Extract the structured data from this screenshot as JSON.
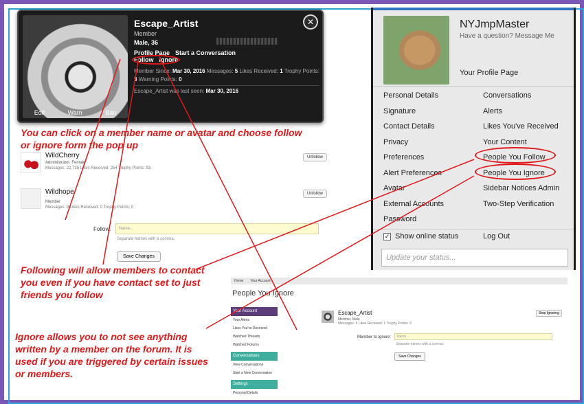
{
  "popup": {
    "name": "Escape_Artist",
    "role": "Member",
    "info": "Male, 36",
    "links_row1": [
      "Profile Page",
      "Start a Conversation"
    ],
    "links_row2": [
      "Follow",
      "Ignore"
    ],
    "stats_line1": "Member Since:",
    "member_since": "Mar 30, 2016",
    "messages_label": "Messages:",
    "messages": "5",
    "likes_label": "Likes Received:",
    "likes": "1",
    "trophy_label": "Trophy Points:",
    "trophy": "3",
    "warning_label": "Warning Points:",
    "warning": "0",
    "last_seen_prefix": "Escape_Artist was last seen:",
    "last_seen": "Mar 30, 2016",
    "avatar_actions": [
      "Edit",
      "Warn",
      "Ban"
    ],
    "close_icon": "close-icon"
  },
  "notes": {
    "n1": "You can click on a member name or avatar and choose follow  or ignore form the pop up",
    "n2": "Following will allow members to contact you even if you have contact set to just friends you follow",
    "n3": "Ignore allows you to not see anything written by a member on the forum. It is used if you are triggered by certain issues or members.",
    "color": "#e01818"
  },
  "following": {
    "members": [
      {
        "name": "WildCherry",
        "role": "Administrator, Female",
        "stats": "Messages: 22,735 Likes Received: 254 Trophy Points: 93",
        "button": "Unfollow"
      },
      {
        "name": "Wildhope",
        "role": "Member",
        "stats": "Messages: 9 Likes Received: 0 Trophy Points: 0",
        "button": "Unfollow"
      }
    ],
    "follow_label": "Follow:",
    "follow_placeholder": "Name...",
    "help": "Separate names with a comma.",
    "save": "Save Changes"
  },
  "account": {
    "username": "NYJmpMaster",
    "subtitle": "Have a question? Message Me",
    "profile_link": "Your Profile Page",
    "left_items": [
      "Personal Details",
      "Signature",
      "Contact Details",
      "Privacy",
      "Preferences",
      "Alert Preferences",
      "Avatar",
      "External Accounts",
      "Password"
    ],
    "right_items": [
      "Conversations",
      "Alerts",
      "Likes You've Received",
      "Your Content",
      "People You Follow",
      "People You Ignore",
      "Sidebar Notices Admin",
      "Two-Step Verification"
    ],
    "show_online": "Show online status",
    "logout": "Log Out",
    "status_placeholder": "Update your status...",
    "accent": "#2f74c1"
  },
  "ignore_page": {
    "breadcrumbs": [
      "Home",
      "Your Account"
    ],
    "title": "People You Ignore",
    "sidebar_sections": [
      {
        "header": "Your Account",
        "items": [
          "Your Alerts",
          "Likes You've Received",
          "Watched Threads",
          "Watched Forums"
        ]
      },
      {
        "header": "Conversations",
        "items": [
          "View Conversations",
          "Start a New Conversation"
        ]
      },
      {
        "header": "Settings",
        "items": [
          "Personal Details"
        ]
      }
    ],
    "member": {
      "name": "Escape_Artist",
      "role": "Member, Male",
      "stats": "Messages: 5 Likes Received: 1 Trophy Points: 3",
      "button": "Stop Ignoring"
    },
    "member_label": "Member to Ignore:",
    "placeholder": "Name...",
    "help": "Separate names with a comma.",
    "save": "Save Changes"
  }
}
